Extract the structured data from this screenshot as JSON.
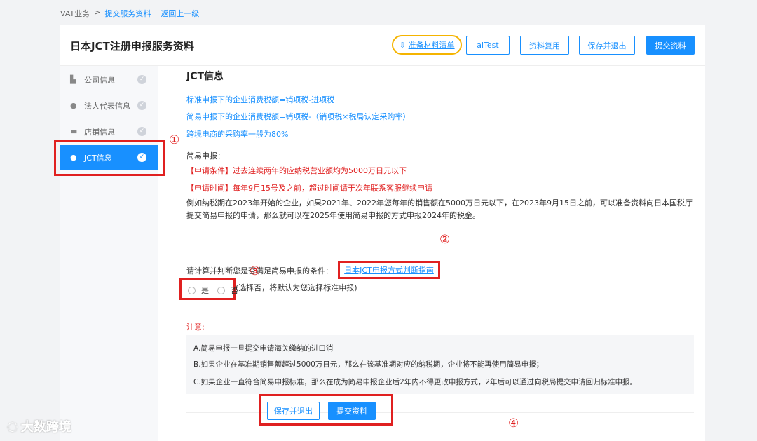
{
  "breadcrumb": {
    "root": "VAT业务",
    "sep": ">",
    "current": "提交服务资料",
    "back": "返回上一级"
  },
  "page_title": "日本JCT注册申报服务资料",
  "header_buttons": {
    "prepare": "准备材料清单",
    "aitest": "aiTest",
    "reuse": "资料复用",
    "save_exit": "保存并退出",
    "submit": "提交资料"
  },
  "sidebar": {
    "items": [
      {
        "label": "公司信息",
        "icon": "building-icon"
      },
      {
        "label": "法人代表信息",
        "icon": "person-icon"
      },
      {
        "label": "店铺信息",
        "icon": "shop-icon"
      },
      {
        "label": "JCT信息",
        "icon": "person-icon",
        "active": true
      }
    ]
  },
  "annotations": {
    "n1": "①",
    "n2": "②",
    "n3": "③",
    "n4": "④"
  },
  "content": {
    "title": "JCT信息",
    "formula1": "标准申报下的企业消费税额=销项税-进项税",
    "formula2": "简易申报下的企业消费税额=销项税-（销项税×税局认定采购率）",
    "rate_note": "跨境电商的采购率一般为80%",
    "simple_title": "简易申报：",
    "condition": "【申请条件】过去连续两年的应纳税营业额均为5000万日元以下",
    "time": "【申请时间】每年9月15号及之前，超过时间请于次年联系客服继续申请",
    "example": "例如纳税期在2023年开始的企业，如果2021年、2022年您每年的销售额在5000万日元以下，在2023年9月15日之前，可以准备资料向日本国税厅提交简易申报的申请，那么就可以在2025年使用简易申报的方式申报2024年的税金。",
    "question": "请计算并判断您是否满足简易申报的条件：",
    "guide_link": "日本JCT申报方式判断指南",
    "yes": "是",
    "no": "否",
    "no_hint": "(选择否，将默认为您选择标准申报)",
    "note_title": "注意:",
    "notes": [
      "A.简易申报一旦提交申请海关缴纳的进口消",
      "B.如果企业在基准期销售额超过5000万日元，那么在该基准期对应的纳税期，企业将不能再使用简易申报；",
      "C.如果企业一直符合简易申报标准，那么在成为简易申报企业后2年内不得更改申报方式，2年后可以通过向税局提交申请回归标准申报。"
    ]
  },
  "footer": {
    "save_exit": "保存并退出",
    "submit": "提交资料"
  },
  "watermark": "大数跨境",
  "colors": {
    "accent": "#1890ff",
    "annotation": "#e02020",
    "highlight": "#f5b400"
  }
}
